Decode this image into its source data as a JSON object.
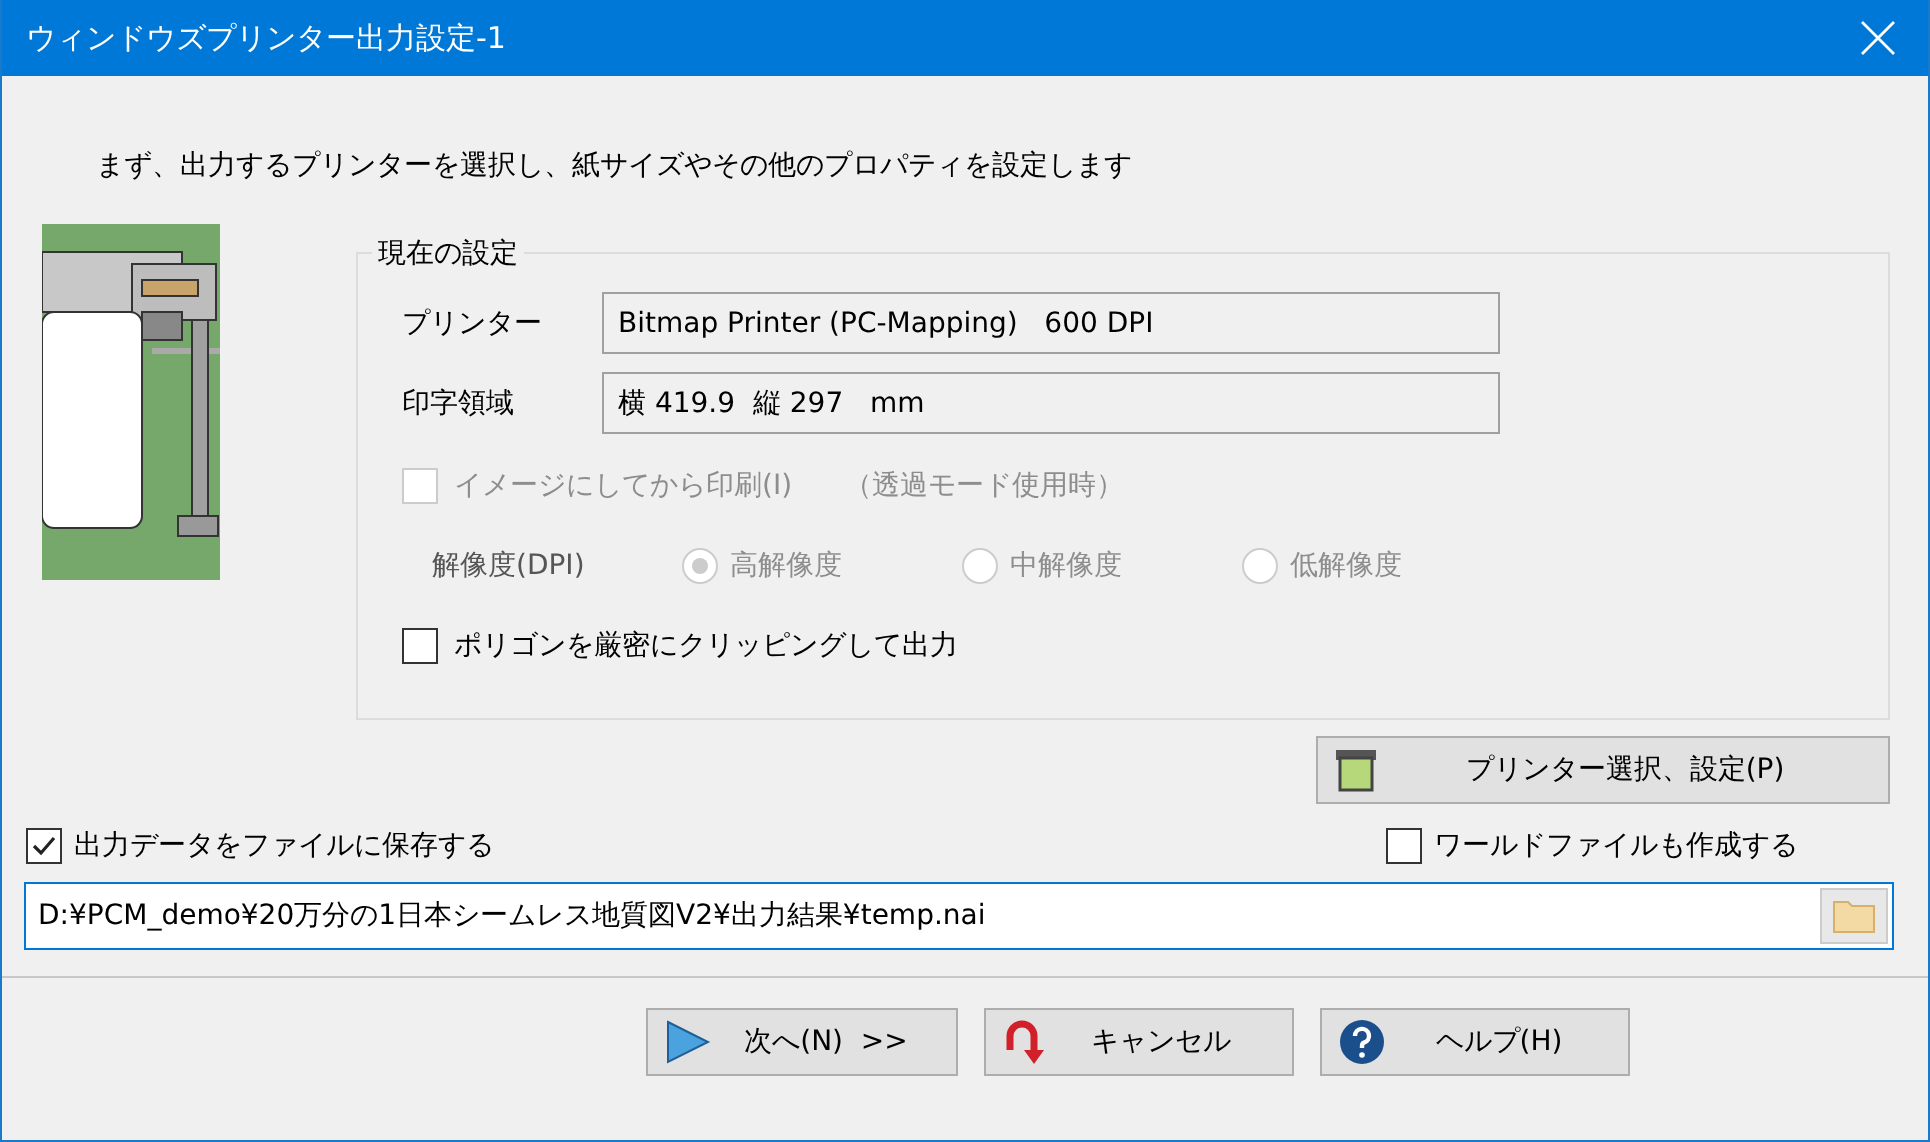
{
  "window": {
    "title": "ウィンドウズプリンター出力設定-1"
  },
  "intro": "まず、出力するプリンターを選択し、紙サイズやその他のプロパティを設定します",
  "current_settings": {
    "title": "現在の設定",
    "fields": [
      {
        "label": "プリンター",
        "value": "Bitmap Printer (PC-Mapping)   600 DPI"
      },
      {
        "label": "印字領域",
        "value": "横 419.9  縦 297   mm"
      }
    ],
    "image_print": {
      "label": "イメージにしてから印刷(I)",
      "note": "（透過モード使用時）",
      "checked": false,
      "disabled": true
    },
    "resolution": {
      "label": "解像度(DPI)",
      "disabled": true,
      "options": [
        {
          "label": "高解像度",
          "selected": true
        },
        {
          "label": "中解像度",
          "selected": false
        },
        {
          "label": "低解像度",
          "selected": false
        }
      ]
    },
    "polygon_clip": {
      "label": "ポリゴンを厳密にクリッピングして出力",
      "checked": false,
      "disabled": false
    }
  },
  "printer_button": "プリンター選択、設定(P)",
  "save_to_file": {
    "label": "出力データをファイルに保存する",
    "checked": true
  },
  "world_file": {
    "label": "ワールドファイルも作成する",
    "checked": false
  },
  "path": "D:¥PCM_demo¥20万分の1日本シームレス地質図V2¥出力結果¥temp.nai",
  "buttons": [
    {
      "kind": "next",
      "label": "次へ(N)  >>"
    },
    {
      "kind": "cancel",
      "label": "キャンセル"
    },
    {
      "kind": "help",
      "label": "ヘルプ(H)"
    }
  ]
}
